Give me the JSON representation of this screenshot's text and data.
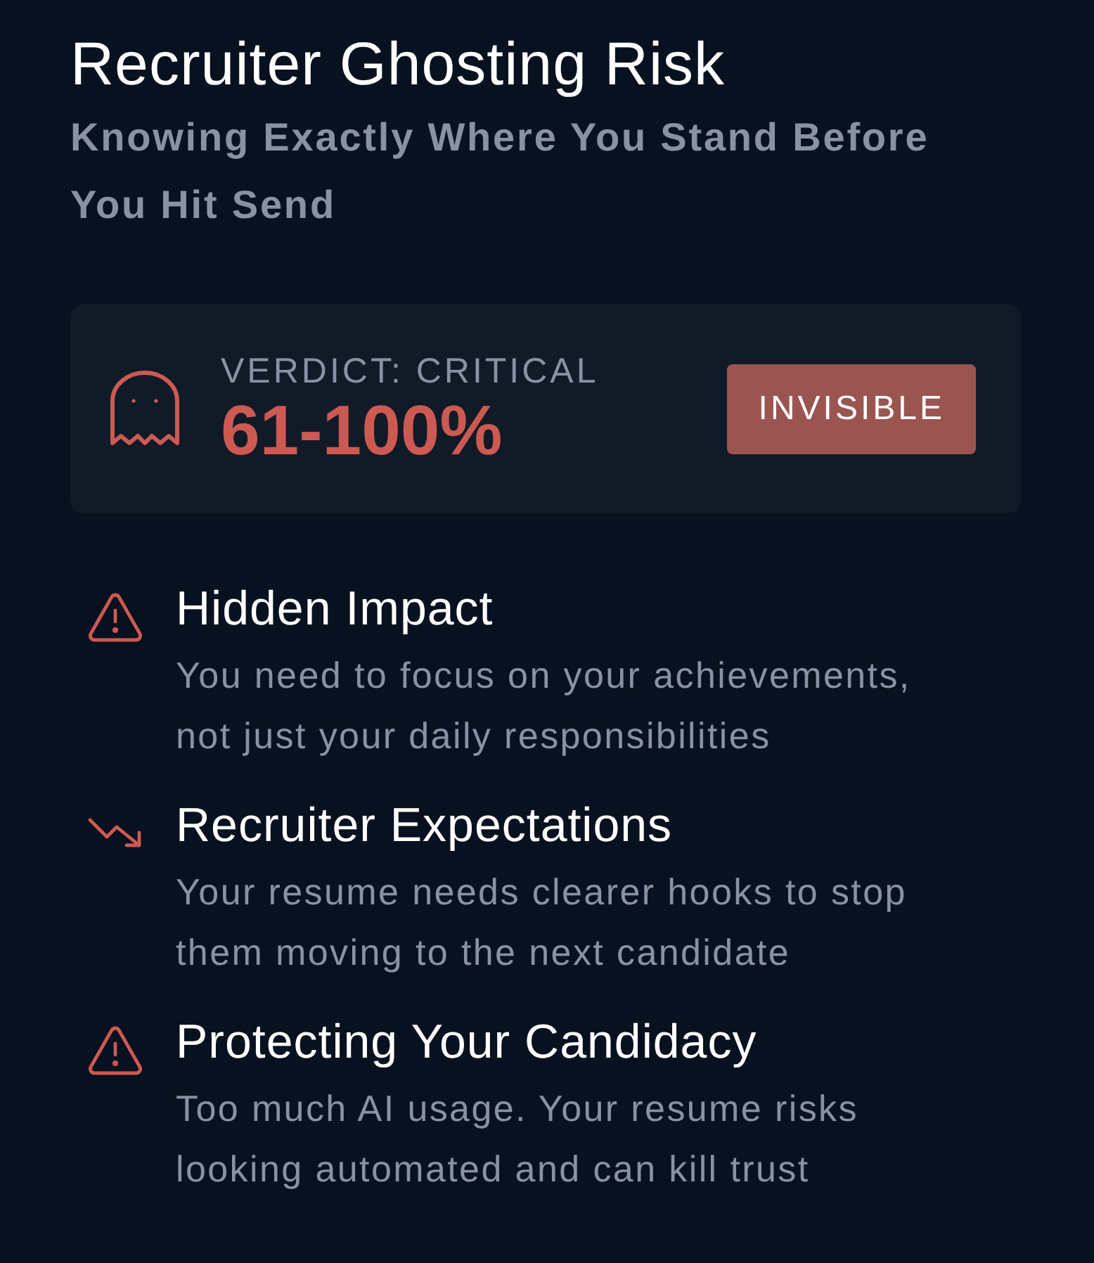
{
  "header": {
    "title": "Recruiter Ghosting Risk",
    "subtitle": "Knowing Exactly Where You Stand Before You Hit Send"
  },
  "verdict": {
    "label": "VERDICT: CRITICAL",
    "range": "61-100%",
    "badge": "INVISIBLE"
  },
  "factors": [
    {
      "kind": "warning",
      "title": "Hidden Impact",
      "description": "You need to focus on your achievements, not just your daily responsibilities"
    },
    {
      "kind": "trend-down",
      "title": "Recruiter Expectations",
      "description": "Your resume needs clearer hooks to stop them moving to the next candidate"
    },
    {
      "kind": "warning",
      "title": "Protecting Your Candidacy",
      "description": "Too much AI usage. Your resume risks looking automated and can kill trust"
    }
  ]
}
